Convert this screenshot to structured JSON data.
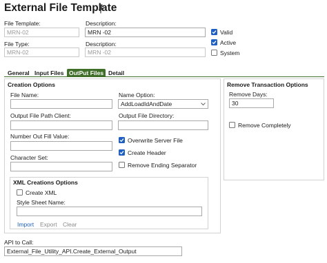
{
  "header": {
    "title": "External File Template"
  },
  "fields": {
    "file_template": {
      "label": "File Template:",
      "value": "MRN-02"
    },
    "description1": {
      "label": "Description:",
      "value": "MRN -02"
    },
    "file_type": {
      "label": "File Type:",
      "value": "MRN-02"
    },
    "description2": {
      "label": "Description:",
      "value": "MRN -02"
    }
  },
  "flags": {
    "valid": {
      "label": "Valid",
      "checked": true
    },
    "active": {
      "label": "Active",
      "checked": true
    },
    "system": {
      "label": "System",
      "checked": false
    }
  },
  "tabs": [
    {
      "label": "General",
      "active": false
    },
    {
      "label": "Input Files",
      "active": false
    },
    {
      "label": "OutPut Files",
      "active": true
    },
    {
      "label": "Detail",
      "active": false
    }
  ],
  "creation": {
    "title": "Creation Options",
    "file_name": {
      "label": "File Name:",
      "value": ""
    },
    "name_option": {
      "label": "Name Option:",
      "value": "AddLoadIdAndDate"
    },
    "output_path_client": {
      "label": "Output File Path Client:",
      "value": ""
    },
    "output_directory": {
      "label": "Output File Directory:",
      "value": ""
    },
    "number_out_fill": {
      "label": "Number Out Fill Value:",
      "value": ""
    },
    "character_set": {
      "label": "Character Set:",
      "value": ""
    },
    "overwrite": {
      "label": "Overwrite Server File",
      "checked": true
    },
    "create_header": {
      "label": "Create Header",
      "checked": true
    },
    "remove_separator": {
      "label": "Remove Ending Separator",
      "checked": false
    }
  },
  "xml": {
    "title": "XML Creations Options",
    "create_xml": {
      "label": "Create XML",
      "checked": false
    },
    "style_sheet": {
      "label": "Style Sheet Name:",
      "value": ""
    },
    "links": {
      "import": "Import",
      "export": "Export",
      "clear": "Clear"
    }
  },
  "remove": {
    "title": "Remove Transaction Options",
    "days": {
      "label": "Remove Days:",
      "value": "30"
    },
    "completely": {
      "label": "Remove Completely",
      "checked": false
    }
  },
  "api": {
    "label": "API to Call:",
    "value": "External_File_Utility_API.Create_External_Output"
  },
  "colors": {
    "accent": "#1e5fbf",
    "tab_active": "#3f6f28",
    "link": "#1e5fbf",
    "disabled": "#8a8a8a"
  },
  "icons": {
    "pin": "pin-icon",
    "check": "checkmark-icon",
    "dropdown": "chevron-down-icon"
  }
}
